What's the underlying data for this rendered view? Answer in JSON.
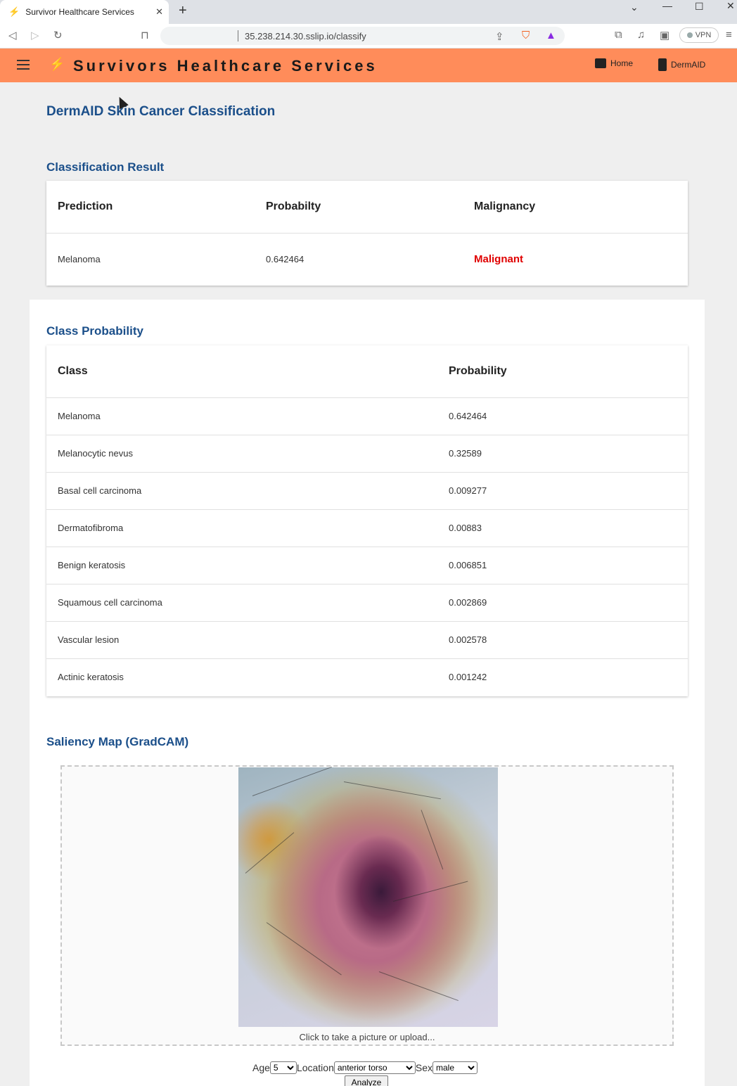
{
  "browser": {
    "tab_title": "Survivor Healthcare Services",
    "url": "35.238.214.30.sslip.io/classify",
    "vpn_label": "VPN"
  },
  "nav": {
    "brand": "Survivors Healthcare Services",
    "home_label": "Home",
    "dermaid_label": "DermAID"
  },
  "page": {
    "title": "DermAID Skin Cancer Classification"
  },
  "classification_result": {
    "heading": "Classification Result",
    "headers": [
      "Prediction",
      "Probabilty",
      "Malignancy"
    ],
    "prediction": "Melanoma",
    "probability": "0.642464",
    "malignancy": "Malignant",
    "malignancy_color": "#e00000"
  },
  "class_probability": {
    "heading": "Class Probability",
    "headers": [
      "Class",
      "Probability"
    ],
    "rows": [
      {
        "class": "Melanoma",
        "probability": "0.642464"
      },
      {
        "class": "Melanocytic nevus",
        "probability": "0.32589"
      },
      {
        "class": "Basal cell carcinoma",
        "probability": "0.009277"
      },
      {
        "class": "Dermatofibroma",
        "probability": "0.00883"
      },
      {
        "class": "Benign keratosis",
        "probability": "0.006851"
      },
      {
        "class": "Squamous cell carcinoma",
        "probability": "0.002869"
      },
      {
        "class": "Vascular lesion",
        "probability": "0.002578"
      },
      {
        "class": "Actinic keratosis",
        "probability": "0.001242"
      }
    ]
  },
  "saliency": {
    "heading": "Saliency Map (GradCAM)",
    "caption": "Click to take a picture or upload..."
  },
  "form": {
    "age_label": "Age",
    "age_value": "5",
    "location_label": "Location",
    "location_value": "anterior torso",
    "sex_label": "Sex",
    "sex_value": "male",
    "analyze_label": "Analyze"
  },
  "colors": {
    "nav_bg": "#ff8c5a",
    "heading": "#1b4f8a"
  }
}
